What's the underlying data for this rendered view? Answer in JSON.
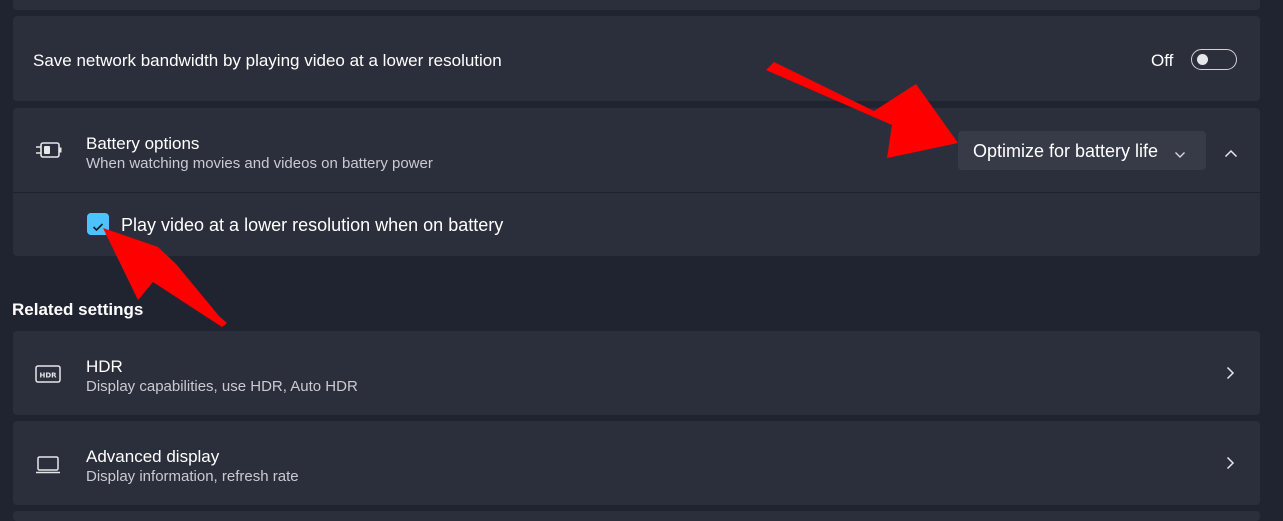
{
  "bandwidth": {
    "label": "Save network bandwidth by playing video at a lower resolution",
    "state_label": "Off",
    "toggle_on": false
  },
  "battery": {
    "title": "Battery options",
    "subtitle": "When watching movies and videos on battery power",
    "icon": "battery-plug-icon",
    "dropdown_value": "Optimize for battery life",
    "checkbox_label": "Play video at a lower resolution when on battery",
    "checkbox_checked": true
  },
  "related": {
    "heading": "Related settings",
    "items": [
      {
        "title": "HDR",
        "subtitle": "Display capabilities, use HDR, Auto HDR",
        "icon": "hdr-icon"
      },
      {
        "title": "Advanced display",
        "subtitle": "Display information, refresh rate",
        "icon": "laptop-icon"
      }
    ]
  },
  "colors": {
    "background": "#202431",
    "card": "#2b2f3b",
    "accent": "#4cc2ff",
    "annotation_arrow": "#ff0000"
  }
}
